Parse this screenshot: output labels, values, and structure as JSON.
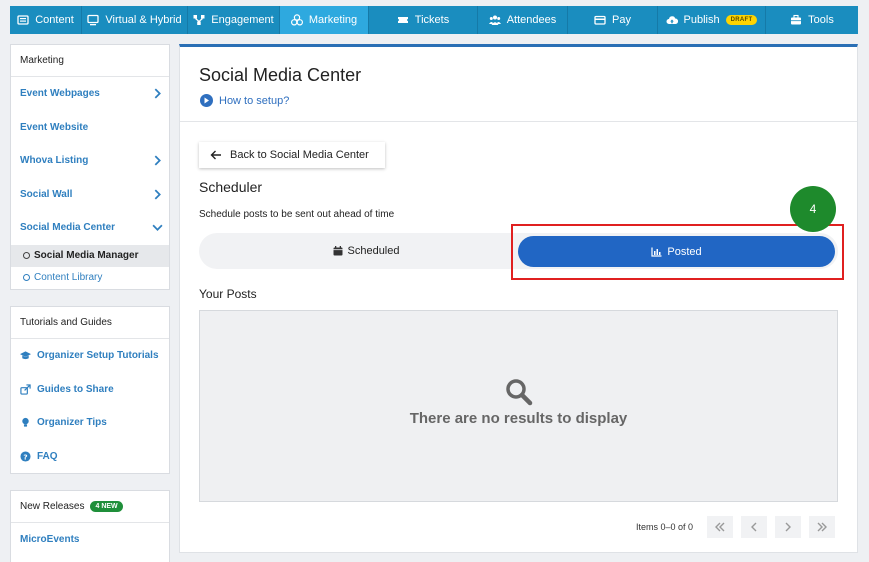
{
  "nav": {
    "tabs": [
      {
        "label": "Content",
        "icon": "content-icon"
      },
      {
        "label": "Virtual & Hybrid",
        "icon": "monitor-icon"
      },
      {
        "label": "Engagement",
        "icon": "engagement-icon"
      },
      {
        "label": "Marketing",
        "icon": "marketing-icon"
      },
      {
        "label": "Tickets",
        "icon": "ticket-icon"
      },
      {
        "label": "Attendees",
        "icon": "attendees-icon"
      },
      {
        "label": "Pay",
        "icon": "pay-icon"
      },
      {
        "label": "Publish",
        "icon": "cloud-upload-icon",
        "badge": "DRAFT"
      },
      {
        "label": "Tools",
        "icon": "toolbox-icon"
      }
    ],
    "active": "Marketing"
  },
  "sidebar": {
    "marketing": {
      "header": "Marketing",
      "items": [
        {
          "label": "Event Webpages"
        },
        {
          "label": "Event Website"
        },
        {
          "label": "Whova Listing"
        },
        {
          "label": "Social Wall"
        },
        {
          "label": "Social Media Center"
        }
      ],
      "subitems": [
        {
          "label": "Social Media Manager"
        },
        {
          "label": "Content Library"
        }
      ]
    },
    "tutorials": {
      "header": "Tutorials and Guides",
      "items": [
        {
          "label": "Organizer Setup Tutorials",
          "icon": "graduation-cap-icon"
        },
        {
          "label": "Guides to Share",
          "icon": "share-icon"
        },
        {
          "label": "Organizer Tips",
          "icon": "lightbulb-icon"
        },
        {
          "label": "FAQ",
          "icon": "question-icon"
        }
      ]
    },
    "releases": {
      "header": "New Releases",
      "badge": "4 NEW",
      "items": [
        {
          "label": "MicroEvents"
        }
      ]
    }
  },
  "main": {
    "title": "Social Media Center",
    "howto": "How to setup?",
    "back_label": "Back to Social Media Center",
    "scheduler_title": "Scheduler",
    "scheduler_desc": "Schedule posts to be sent out ahead of time",
    "toggle": {
      "scheduled": "Scheduled",
      "posted": "Posted"
    },
    "step_number": "4",
    "posts_title": "Your Posts",
    "empty_text": "There are no results to display",
    "pager_text": "Items 0–0 of 0"
  },
  "colors": {
    "nav_bg": "#1a8dbf",
    "nav_active": "#2ea9df",
    "link_blue": "#2f7fbf",
    "posted_blue": "#2166c4",
    "highlight_red": "#e02020",
    "step_green": "#1e8a2c",
    "draft_yellow": "#ffd400"
  }
}
